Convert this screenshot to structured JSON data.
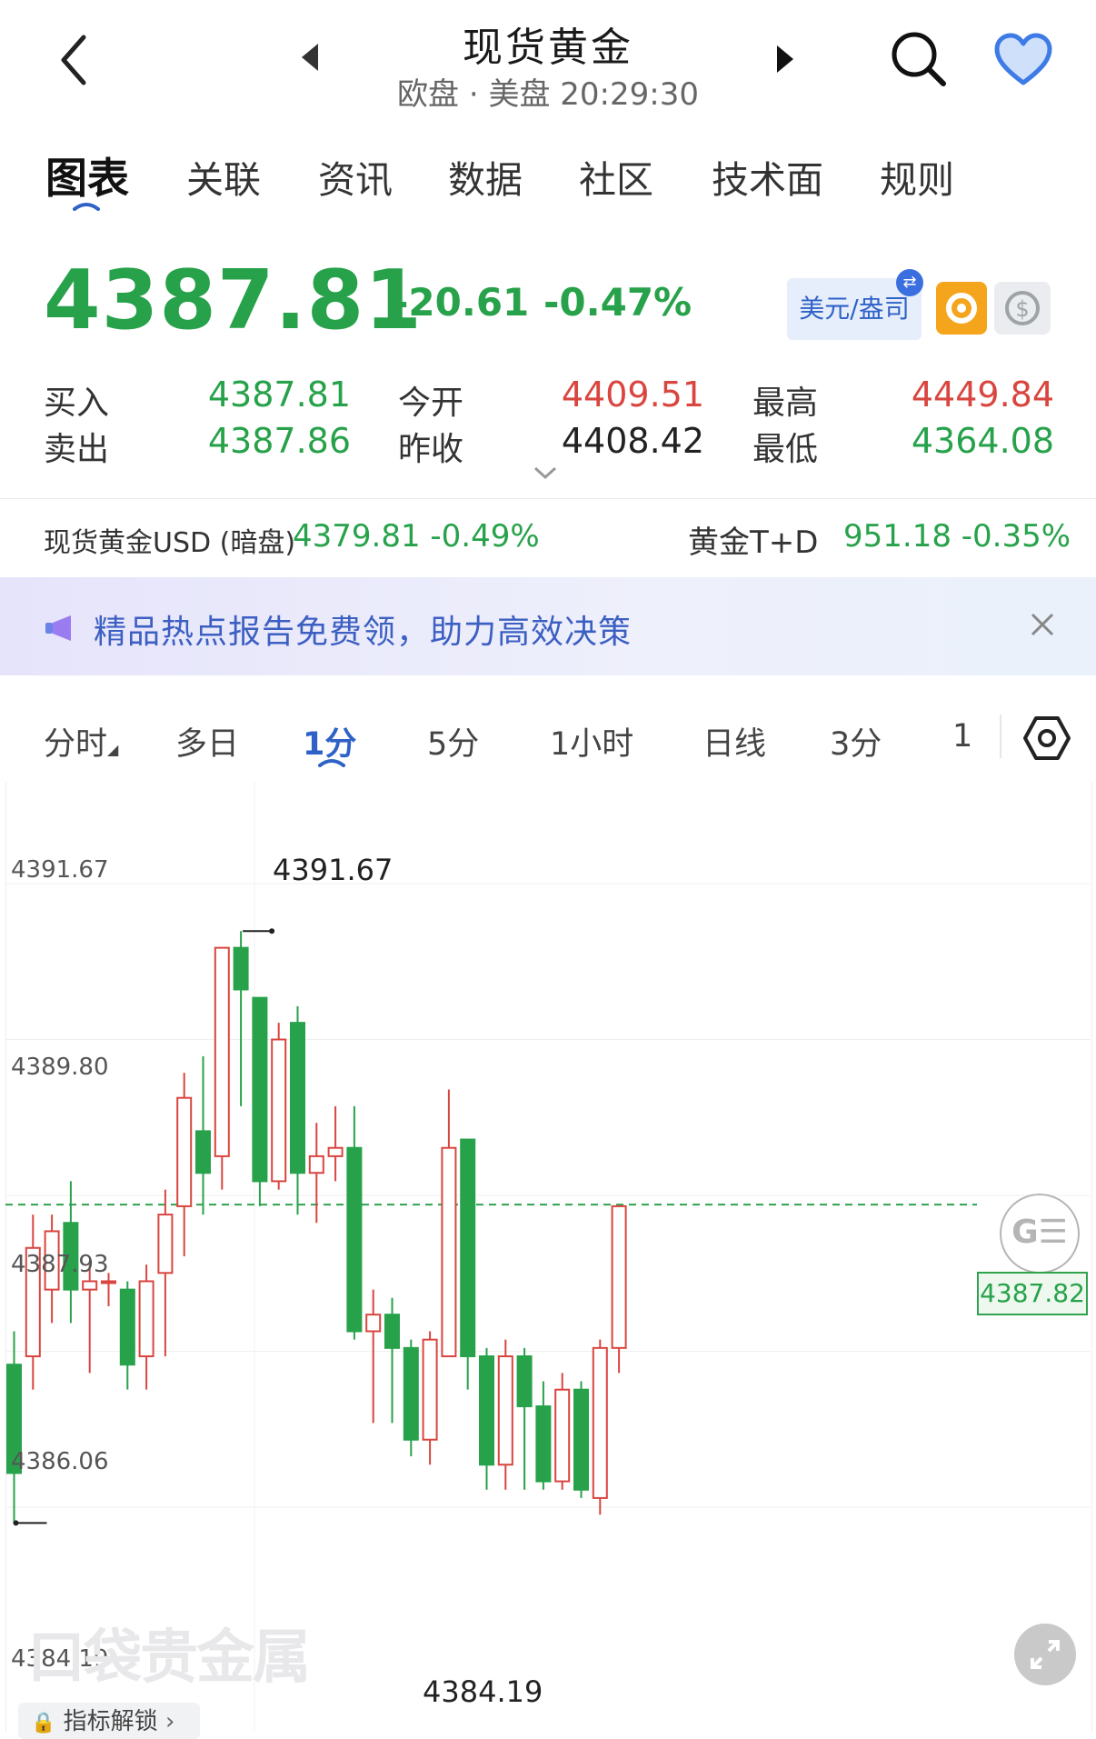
{
  "header": {
    "title": "现货黄金",
    "subtitle": "欧盘 · 美盘 20:29:30"
  },
  "tabs": [
    {
      "label": "图表",
      "active": true
    },
    {
      "label": "关联"
    },
    {
      "label": "资讯"
    },
    {
      "label": "数据"
    },
    {
      "label": "社区"
    },
    {
      "label": "技术面"
    },
    {
      "label": "规则"
    }
  ],
  "quote": {
    "price": "4387.81",
    "change": "-20.61",
    "change_pct": "-0.47%",
    "currency_label": "美元/盎司",
    "bid_label": "买入",
    "bid": "4387.81",
    "ask_label": "卖出",
    "ask": "4387.86",
    "open_label": "今开",
    "open": "4409.51",
    "prev_close_label": "昨收",
    "prev_close": "4408.42",
    "high_label": "最高",
    "high": "4449.84",
    "low_label": "最低",
    "low": "4364.08"
  },
  "related": {
    "left_label": "现货黄金USD (暗盘)",
    "left_value": "4379.81 -0.49%",
    "right_label": "黄金T+D",
    "right_value": "951.18 -0.35%"
  },
  "banner": {
    "text": "精品热点报告免费领，助力高效决策"
  },
  "periods": [
    "分时",
    "多日",
    "1分",
    "5分",
    "1小时",
    "日线",
    "3分",
    "1"
  ],
  "active_period": "1分",
  "chart_labels": {
    "high_annot": "4391.67",
    "low_annot": "4384.19",
    "last_price": "4387.82",
    "watermark": "口袋贵金属",
    "unlock": "指标解锁"
  },
  "colors": {
    "up": "#d9453f",
    "down": "#27a24a",
    "accent": "#2f62c7"
  },
  "chart_data": {
    "type": "candlestick",
    "y_ticks": [
      "4391.67",
      "4389.80",
      "4387.93",
      "4386.06",
      "4384.19"
    ],
    "ylim": [
      4384.19,
      4391.67
    ],
    "last_price": 4387.82,
    "candles": [
      {
        "o": 4385.9,
        "c": 4384.6,
        "h": 4386.3,
        "l": 4384.0
      },
      {
        "o": 4386.0,
        "c": 4387.3,
        "h": 4387.7,
        "l": 4385.6
      },
      {
        "o": 4386.8,
        "c": 4387.5,
        "h": 4387.7,
        "l": 4386.4
      },
      {
        "o": 4387.6,
        "c": 4386.8,
        "h": 4388.1,
        "l": 4386.4
      },
      {
        "o": 4386.8,
        "c": 4386.9,
        "h": 4387.1,
        "l": 4385.8
      },
      {
        "o": 4386.9,
        "c": 4386.9,
        "h": 4387.0,
        "l": 4386.6
      },
      {
        "o": 4386.8,
        "c": 4385.9,
        "h": 4386.9,
        "l": 4385.6
      },
      {
        "o": 4386.0,
        "c": 4386.9,
        "h": 4387.1,
        "l": 4385.6
      },
      {
        "o": 4387.0,
        "c": 4387.7,
        "h": 4388.0,
        "l": 4386.0
      },
      {
        "o": 4387.8,
        "c": 4389.1,
        "h": 4389.4,
        "l": 4387.2
      },
      {
        "o": 4388.7,
        "c": 4388.2,
        "h": 4389.6,
        "l": 4387.7
      },
      {
        "o": 4388.4,
        "c": 4390.9,
        "h": 4390.9,
        "l": 4388.0
      },
      {
        "o": 4390.9,
        "c": 4390.4,
        "h": 4391.1,
        "l": 4389.0
      },
      {
        "o": 4390.3,
        "c": 4388.1,
        "h": 4390.3,
        "l": 4387.8
      },
      {
        "o": 4388.1,
        "c": 4389.8,
        "h": 4390.0,
        "l": 4388.0
      },
      {
        "o": 4390.0,
        "c": 4388.2,
        "h": 4390.2,
        "l": 4387.7
      },
      {
        "o": 4388.2,
        "c": 4388.4,
        "h": 4388.8,
        "l": 4387.6
      },
      {
        "o": 4388.4,
        "c": 4388.5,
        "h": 4389.0,
        "l": 4388.1
      },
      {
        "o": 4388.5,
        "c": 4386.3,
        "h": 4389.0,
        "l": 4386.2
      },
      {
        "o": 4386.3,
        "c": 4386.5,
        "h": 4386.8,
        "l": 4385.2
      },
      {
        "o": 4386.5,
        "c": 4386.1,
        "h": 4386.7,
        "l": 4385.2
      },
      {
        "o": 4386.1,
        "c": 4385.0,
        "h": 4386.2,
        "l": 4384.8
      },
      {
        "o": 4385.0,
        "c": 4386.2,
        "h": 4386.3,
        "l": 4384.7
      },
      {
        "o": 4386.0,
        "c": 4388.5,
        "h": 4389.2,
        "l": 4386.0
      },
      {
        "o": 4388.6,
        "c": 4386.0,
        "h": 4388.6,
        "l": 4385.6
      },
      {
        "o": 4386.0,
        "c": 4384.7,
        "h": 4386.1,
        "l": 4384.4
      },
      {
        "o": 4384.7,
        "c": 4386.0,
        "h": 4386.2,
        "l": 4384.4
      },
      {
        "o": 4386.0,
        "c": 4385.4,
        "h": 4386.1,
        "l": 4384.4
      },
      {
        "o": 4385.4,
        "c": 4384.5,
        "h": 4385.7,
        "l": 4384.4
      },
      {
        "o": 4384.5,
        "c": 4385.6,
        "h": 4385.8,
        "l": 4384.4
      },
      {
        "o": 4385.6,
        "c": 4384.4,
        "h": 4385.7,
        "l": 4384.3
      },
      {
        "o": 4384.3,
        "c": 4386.1,
        "h": 4386.2,
        "l": 4384.1
      },
      {
        "o": 4386.1,
        "c": 4387.8,
        "h": 4387.8,
        "l": 4385.8
      }
    ]
  }
}
